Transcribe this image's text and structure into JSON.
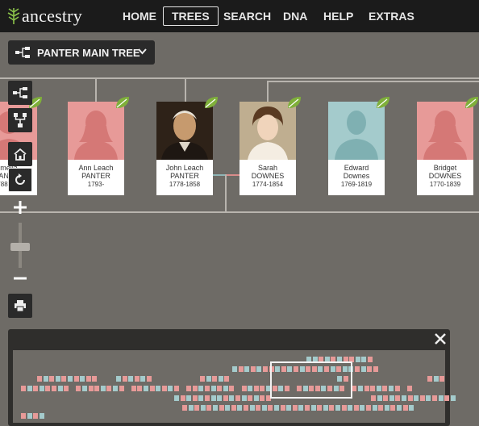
{
  "brand": {
    "name": "ancestry"
  },
  "nav": {
    "items": [
      {
        "label": "HOME",
        "active": false
      },
      {
        "label": "TREES",
        "active": true
      },
      {
        "label": "SEARCH",
        "active": false
      },
      {
        "label": "DNA",
        "active": false
      },
      {
        "label": "HELP",
        "active": false
      },
      {
        "label": "EXTRAS",
        "active": false
      }
    ]
  },
  "tree_selector": {
    "label": "PANTER MAIN TREE"
  },
  "people": [
    {
      "name": "melia",
      "surname": "PANTER",
      "dates": "1788-1871",
      "sex": "female"
    },
    {
      "name": "Ann Leach",
      "surname": "PANTER",
      "dates": "1793-",
      "sex": "female"
    },
    {
      "name": "John Leach",
      "surname": "PANTER",
      "dates": "1778-1858",
      "sex": "male",
      "photo": true
    },
    {
      "name": "Sarah",
      "surname": "DOWNES",
      "dates": "1774-1854",
      "sex": "female",
      "photo": true
    },
    {
      "name": "Edward",
      "surname": "Downes",
      "dates": "1769-1819",
      "sex": "male"
    },
    {
      "name": "Bridget",
      "surname": "DOWNES",
      "dates": "1770-1839",
      "sex": "female"
    }
  ],
  "sidebar_tools": [
    "tree-view-icon",
    "family-view-icon",
    "home-icon",
    "reset-icon",
    "zoom-in-icon",
    "zoom-slider",
    "zoom-out-icon",
    "print-icon"
  ],
  "colors": {
    "female": "#e79a98",
    "male": "#a4cbcc",
    "hint_leaf": "#7fb03a",
    "background": "#6e6b66",
    "topbar": "#1b1b1b"
  },
  "zoom_level": 0.5
}
